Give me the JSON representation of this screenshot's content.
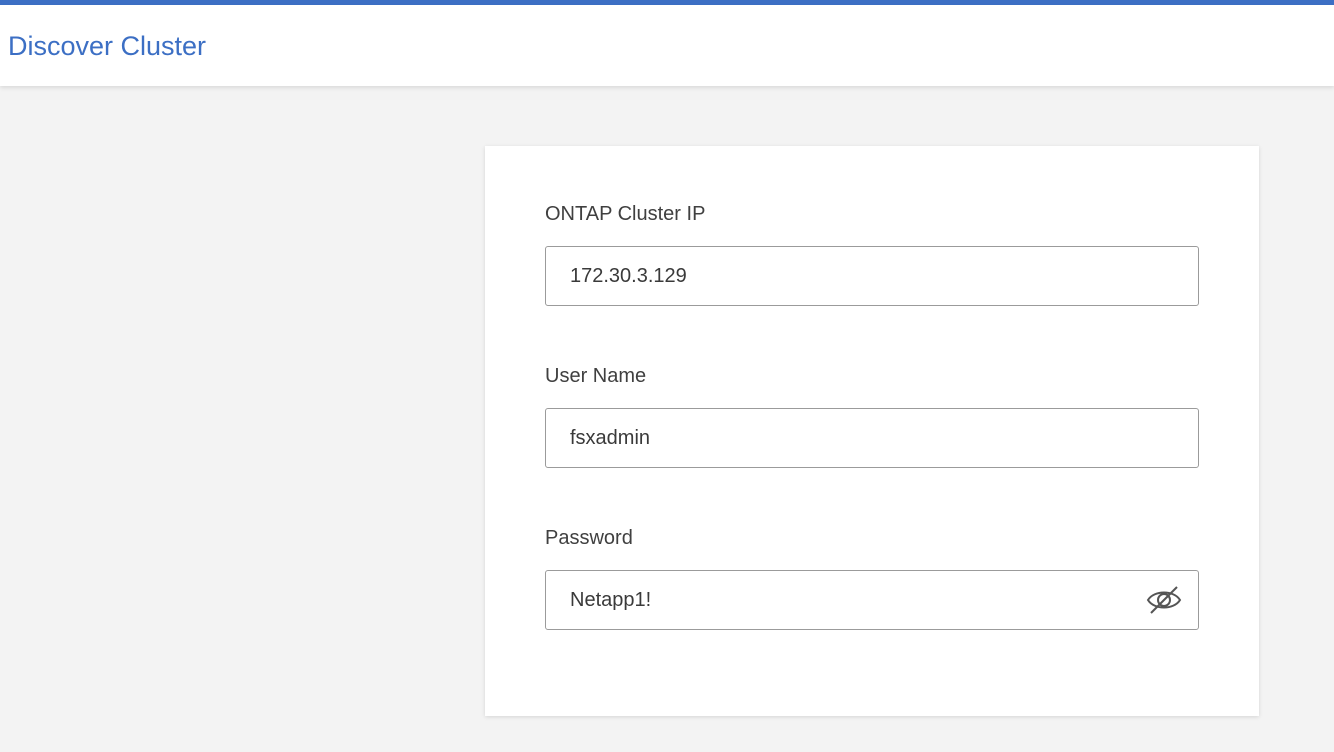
{
  "header": {
    "title": "Discover Cluster",
    "accent_color": "#3c6fc4"
  },
  "form": {
    "cluster_ip": {
      "label": "ONTAP Cluster IP",
      "value": "172.30.3.129"
    },
    "user_name": {
      "label": "User Name",
      "value": "fsxadmin"
    },
    "password": {
      "label": "Password",
      "value": "Netapp1!",
      "visibility_icon": "eye-off-icon"
    }
  }
}
